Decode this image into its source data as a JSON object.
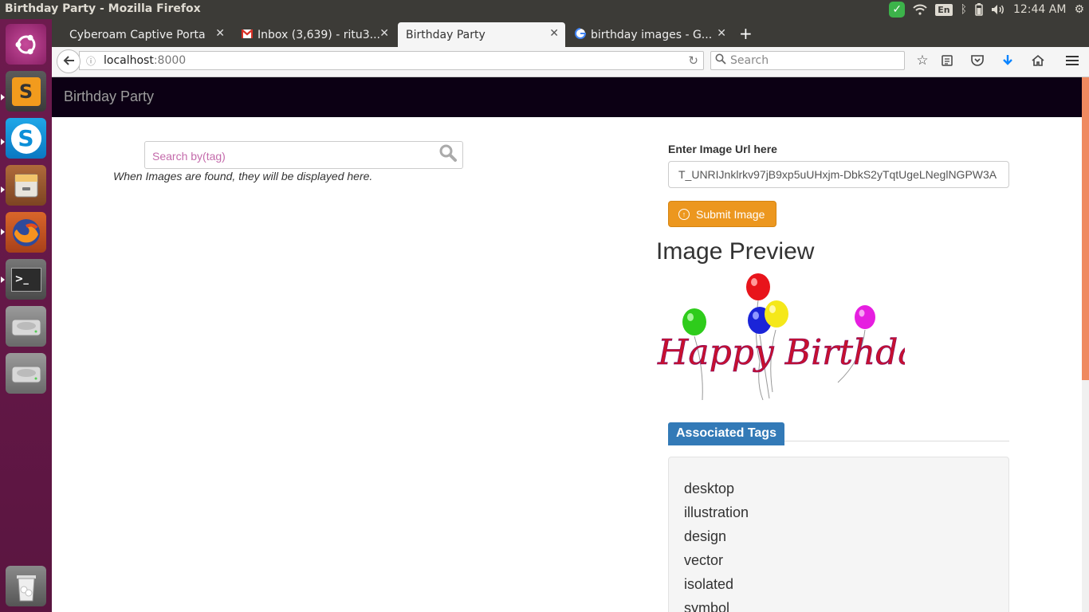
{
  "window": {
    "title": "Birthday Party - Mozilla Firefox"
  },
  "system_tray": {
    "keyboard_layout": "En",
    "clock": "12:44 AM"
  },
  "launcher": {
    "items": [
      {
        "name": "ubuntu-dash"
      },
      {
        "name": "sublime-text",
        "glyph": "S"
      },
      {
        "name": "skype",
        "glyph": "S"
      },
      {
        "name": "files"
      },
      {
        "name": "firefox"
      },
      {
        "name": "terminal",
        "glyph": ">_"
      },
      {
        "name": "disk-1"
      },
      {
        "name": "disk-2"
      },
      {
        "name": "trash"
      }
    ]
  },
  "tabs": [
    {
      "label": "Cyberoam Captive Portal",
      "active": false
    },
    {
      "label": "Inbox (3,639) - ritu3...",
      "active": false
    },
    {
      "label": "Birthday Party",
      "active": true
    },
    {
      "label": "birthday images - G...",
      "active": false
    }
  ],
  "navbar": {
    "url_host": "localhost",
    "url_port": ":8000",
    "search_placeholder": "Search"
  },
  "page": {
    "brand": "Birthday Party",
    "search_placeholder": "Search by(tag)",
    "search_hint": "When Images are found, they will be displayed here.",
    "url_label": "Enter Image Url here",
    "url_value": "T_UNRIJnklrkv97jB9xp5uUHxjm-DbkS2yTqtUgeLNeglNGPW3A",
    "submit_label": "Submit Image",
    "preview_title": "Image Preview",
    "preview_text": "Happy Birthday",
    "tags_title": "Associated Tags",
    "tags": [
      "desktop",
      "illustration",
      "design",
      "vector",
      "isolated",
      "symbol"
    ]
  },
  "colors": {
    "site_nav_bg": "#0c0014",
    "submit_bg": "#ec971f",
    "tags_badge_bg": "#337ab7",
    "launcher_bg": "#6d1b4e"
  }
}
